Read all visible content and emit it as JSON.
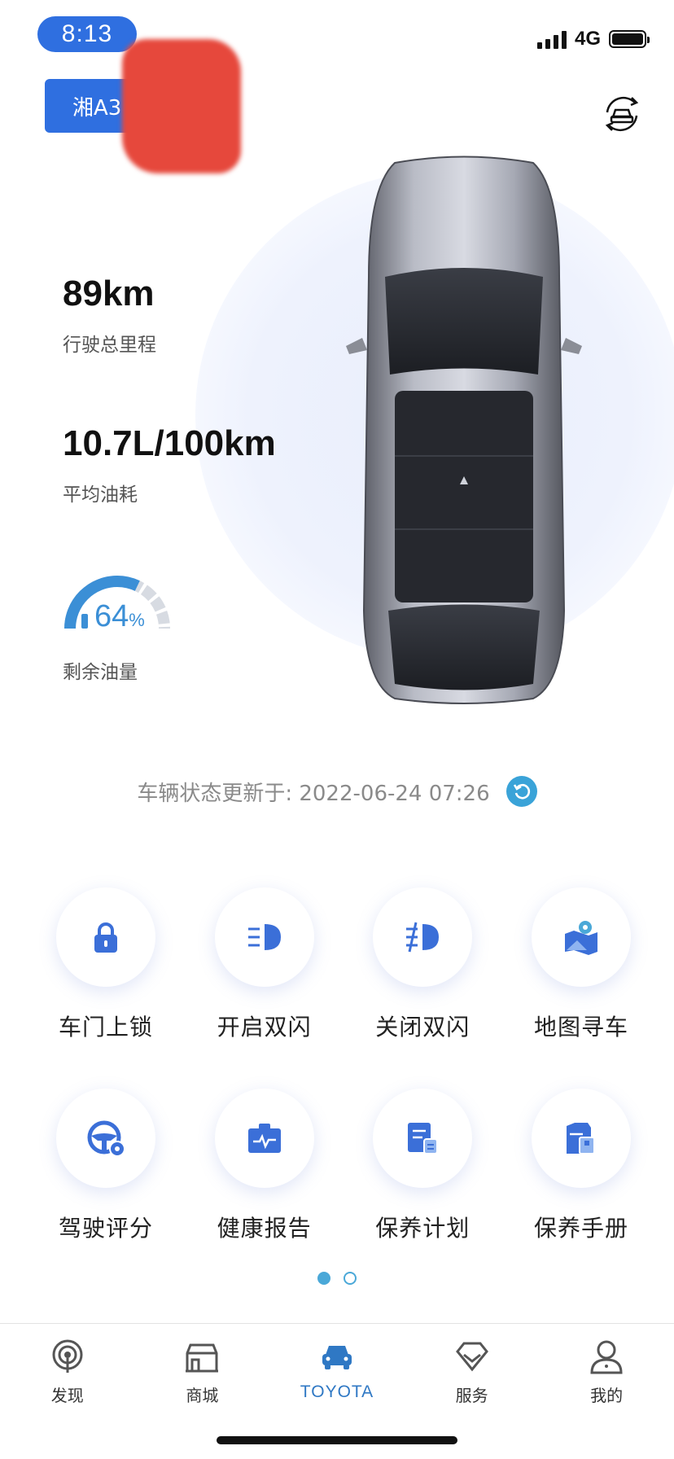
{
  "status_bar": {
    "time": "8:13",
    "network": "4G"
  },
  "vehicle": {
    "plate": "湘A3"
  },
  "stats": [
    {
      "value": "89km",
      "label": "行驶总里程"
    },
    {
      "value": "10.7L/100km",
      "label": "平均油耗"
    }
  ],
  "fuel": {
    "percent": "64",
    "unit": "%",
    "label": "剩余油量",
    "level": 0.64
  },
  "update": {
    "text": "车辆状态更新于: 2022-06-24 07:26"
  },
  "functions": [
    {
      "label": "车门上锁",
      "icon": "lock-icon"
    },
    {
      "label": "开启双闪",
      "icon": "headlight-on-icon"
    },
    {
      "label": "关闭双闪",
      "icon": "headlight-off-icon"
    },
    {
      "label": "地图寻车",
      "icon": "map-pin-icon"
    },
    {
      "label": "驾驶评分",
      "icon": "steering-wheel-icon"
    },
    {
      "label": "健康报告",
      "icon": "health-report-icon"
    },
    {
      "label": "保养计划",
      "icon": "maintenance-plan-icon"
    },
    {
      "label": "保养手册",
      "icon": "maintenance-manual-icon"
    }
  ],
  "pagination": {
    "pages": 2,
    "current": 1
  },
  "tabs": [
    {
      "label": "发现",
      "icon": "discover-icon"
    },
    {
      "label": "商城",
      "icon": "store-icon"
    },
    {
      "label": "TOYOTA",
      "icon": "car-icon",
      "active": true
    },
    {
      "label": "服务",
      "icon": "service-diamond-icon"
    },
    {
      "label": "我的",
      "icon": "profile-icon"
    }
  ],
  "colors": {
    "accent": "#2f6fe0",
    "icon_blue": "#3b8fd6",
    "refresh": "#3aa3d8",
    "active_tab": "#2f78c4"
  }
}
